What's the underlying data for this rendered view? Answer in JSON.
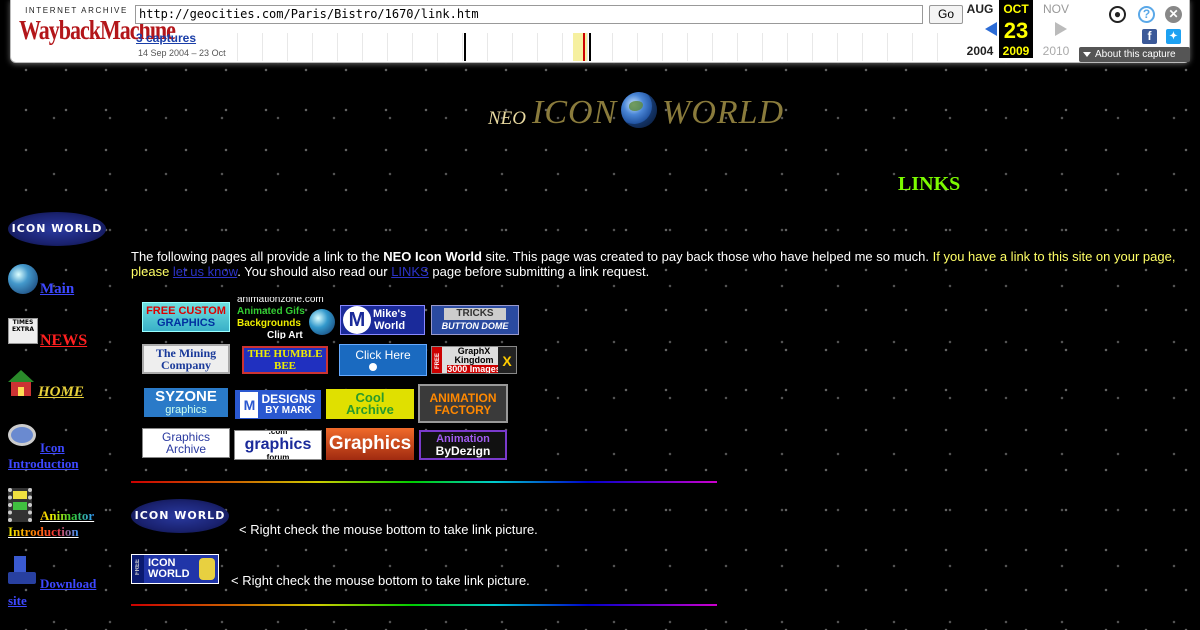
{
  "wayback": {
    "logo_top": "INTERNET ARCHIVE",
    "logo_main": "WaybackMachine",
    "url": "http://geocities.com/Paris/Bistro/1670/link.htm",
    "go_label": "Go",
    "captures": "3 captures",
    "range": "14 Sep 2004 – 23 Oct",
    "months": {
      "prev": "AUG",
      "current": "OCT",
      "next": "NOV"
    },
    "day": "23",
    "years": {
      "prev": "2004",
      "current": "2009",
      "next": "2010"
    },
    "about": "About this capture"
  },
  "site": {
    "title_neo": "NEO",
    "title_icon": "ICON",
    "title_world": "WORLD",
    "links_heading": "LINKS"
  },
  "nav": {
    "badge": "ICON WORLD",
    "main": "Main",
    "news": "NEWS",
    "home": "HOME",
    "intro_line1": "Icon",
    "intro_line2": "Introduction",
    "anim_line1": "Animator",
    "anim_line2": "Introduction",
    "download_line1": "Download",
    "download_line2": "site",
    "news_icon_text": "TIMES EXTRA"
  },
  "intro": {
    "part1": "The following pages all provide a link to the ",
    "bold": "NEO Icon World",
    "part2": " site. This page was created to pay back those who have helped me so much. ",
    "highlight": "If you have a link to this site on your page, please ",
    "link1": "let us know",
    "part3": ". You should also read our ",
    "link2": "LINKS",
    "part4": " page before submitting a link request."
  },
  "banners": [
    {
      "line1": "FREE CUSTOM",
      "line2": "GRAPHICS"
    },
    {
      "line1": "animationzone.com",
      "line2": "Animated Gifs",
      "line3": "Backgrounds",
      "line4": "Clip Art"
    },
    {
      "line1": "Mike's",
      "line2": "World"
    },
    {
      "line1": "TRICKS",
      "line2": "BUTTON DOME"
    },
    {
      "line1": "The Mining",
      "line2": "Company"
    },
    {
      "line1": "THE HUMBLE BEE"
    },
    {
      "line1": "Click Here"
    },
    {
      "line1": "GraphX",
      "line2": "Kingdom",
      "line3": "3000 Images",
      "side": "FREE"
    },
    {
      "line1": "SYZONE",
      "line2": "graphics"
    },
    {
      "line1": "DESIGNS",
      "line2": "BY MARK"
    },
    {
      "line1": "Cool",
      "line2": "Archive"
    },
    {
      "line1": "ANIMATION",
      "line2": "FACTORY"
    },
    {
      "line1": "Graphics",
      "line2": "Archive"
    },
    {
      "line1": ".com",
      "line2": "graphics",
      "line3": "forum"
    },
    {
      "line1": "Graphics"
    },
    {
      "line1": "Animation",
      "line2": "ByDezign"
    }
  ],
  "link_badges": {
    "badge1": "ICON WORLD",
    "note1": "< Right check the mouse bottom to take link picture.",
    "badge2_line1": "ICON",
    "badge2_line2": "WORLD",
    "badge2_side": "FREE",
    "note2": "< Right check the mouse bottom to take link picture."
  },
  "colors": {
    "links_heading": "#7cfc00",
    "highlight_text": "#ffff66",
    "nav_link": "#3d48ff",
    "news": "#ff2020"
  }
}
